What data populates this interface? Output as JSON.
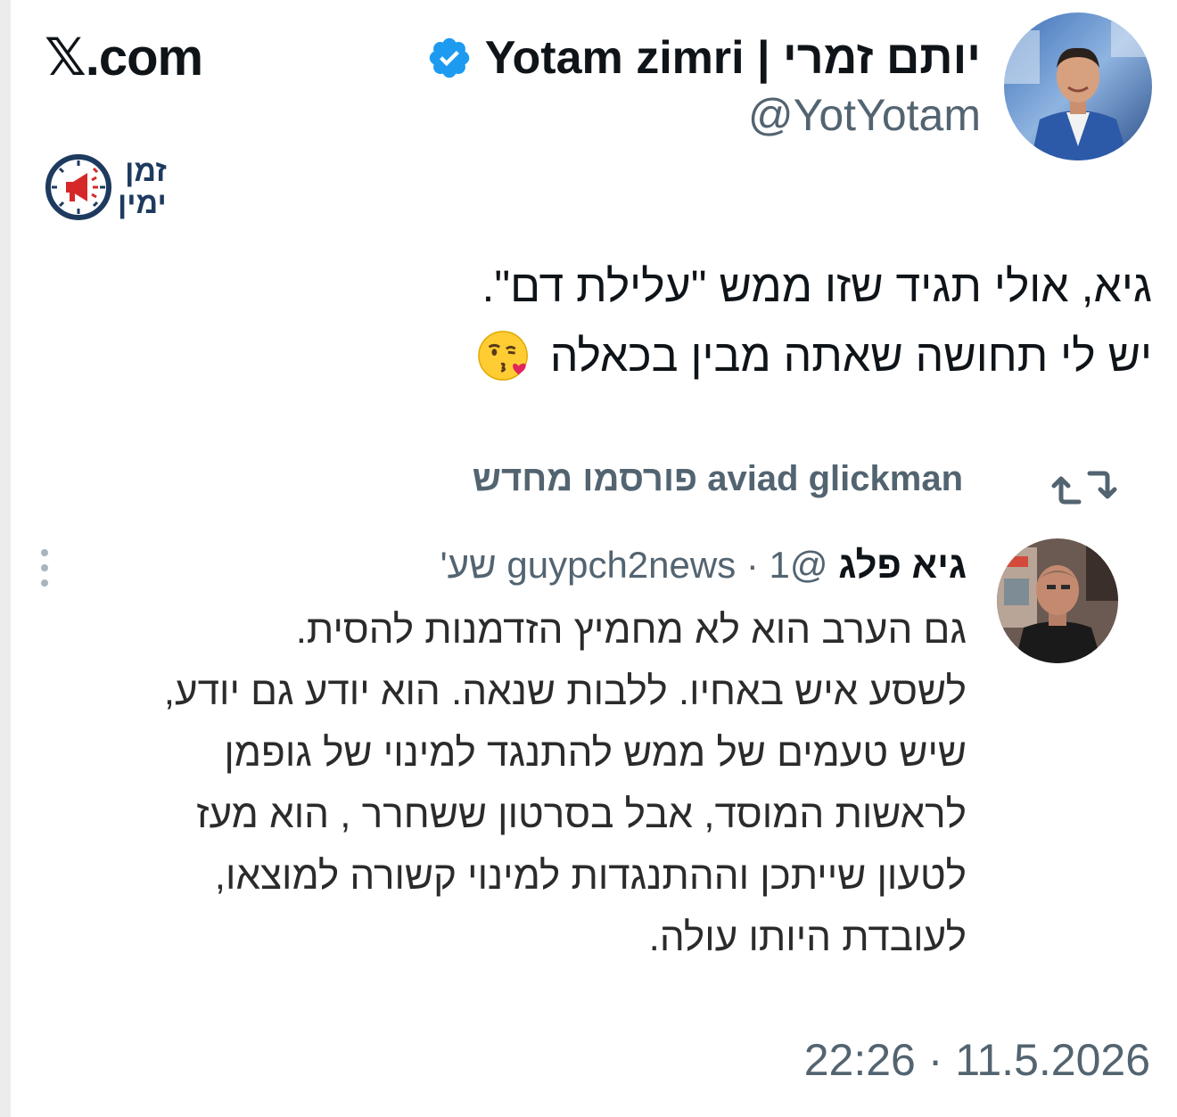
{
  "header": {
    "site_logo": "𝕏.com",
    "author_name": "יותם זמרי | Yotam zimri",
    "author_handle": "@YotYotam"
  },
  "brand": {
    "line1": "זמן",
    "line2": "ימין"
  },
  "tweet": {
    "lines": [
      "גיא, אולי תגיד שזו ממש \"עלילת דם\".",
      "יש לי תחושה שאתה מבין בכאלה"
    ],
    "emoji": "face-blowing-kiss"
  },
  "embedded": {
    "repost_text": "aviad glickman פורסמו מחדש",
    "quoted_name": "גיא פלג",
    "quoted_meta": "@guypch2news · 1 שע'",
    "quoted_lines": [
      "גם הערב הוא לא מחמיץ הזדמנות להסית.",
      "לשסע איש באחיו. ללבות שנאה. הוא יודע גם יודע,",
      "שיש טעמים של ממש להתנגד למינוי של גופמן",
      "לראשות המוסד, אבל בסרטון ששחרר , הוא מעז",
      "לטעון שייתכן וההתנגדות למינוי  קשורה למוצאו,",
      "לעובדת היותו עולה."
    ]
  },
  "footer": {
    "timestamp": "22:26 · 11.5.2026"
  },
  "colors": {
    "text": "#0f1419",
    "secondary": "#536471",
    "verified": "#1d9bf0",
    "brand_navy": "#1e3a5f",
    "brand_red": "#d62828"
  }
}
